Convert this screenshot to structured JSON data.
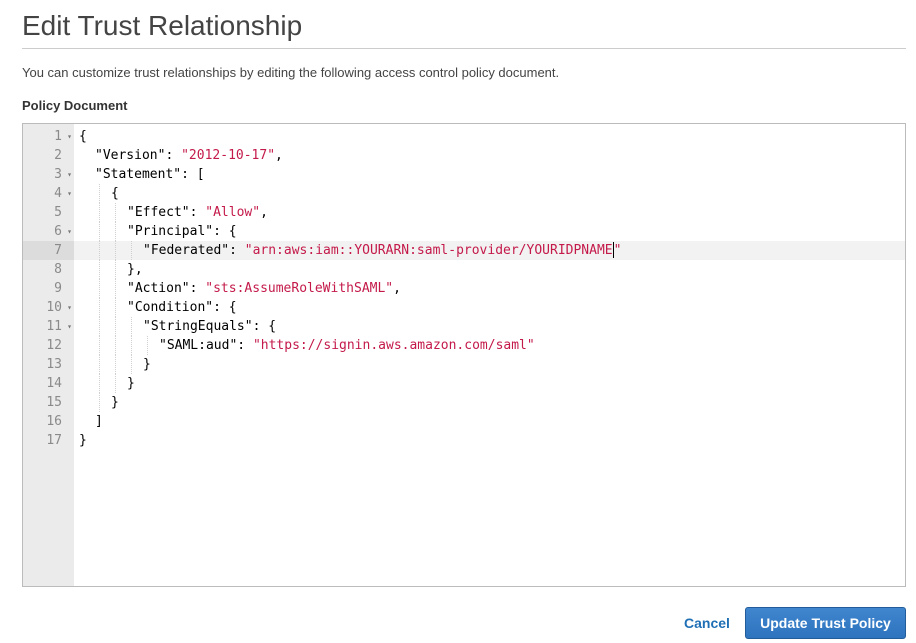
{
  "header": {
    "title": "Edit Trust Relationship",
    "description": "You can customize trust relationships by editing the following access control policy document."
  },
  "editor": {
    "label": "Policy Document",
    "active_line": 7,
    "lines": [
      {
        "number": "1",
        "foldable": true,
        "indent": 0,
        "tokens": [
          {
            "t": "punc",
            "v": "{"
          }
        ]
      },
      {
        "number": "2",
        "foldable": false,
        "indent": 1,
        "tokens": [
          {
            "t": "key",
            "v": "\"Version\""
          },
          {
            "t": "punc",
            "v": ": "
          },
          {
            "t": "str",
            "v": "\"2012-10-17\""
          },
          {
            "t": "punc",
            "v": ","
          }
        ]
      },
      {
        "number": "3",
        "foldable": true,
        "indent": 1,
        "tokens": [
          {
            "t": "key",
            "v": "\"Statement\""
          },
          {
            "t": "punc",
            "v": ": ["
          }
        ]
      },
      {
        "number": "4",
        "foldable": true,
        "indent": 2,
        "tokens": [
          {
            "t": "punc",
            "v": "{"
          }
        ]
      },
      {
        "number": "5",
        "foldable": false,
        "indent": 3,
        "tokens": [
          {
            "t": "key",
            "v": "\"Effect\""
          },
          {
            "t": "punc",
            "v": ": "
          },
          {
            "t": "str",
            "v": "\"Allow\""
          },
          {
            "t": "punc",
            "v": ","
          }
        ]
      },
      {
        "number": "6",
        "foldable": true,
        "indent": 3,
        "tokens": [
          {
            "t": "key",
            "v": "\"Principal\""
          },
          {
            "t": "punc",
            "v": ": {"
          }
        ]
      },
      {
        "number": "7",
        "foldable": false,
        "indent": 4,
        "tokens": [
          {
            "t": "key",
            "v": "\"Federated\""
          },
          {
            "t": "punc",
            "v": ": "
          },
          {
            "t": "str",
            "v": "\"arn:aws:iam::YOURARN:saml-provider/YOURIDPNAME"
          },
          {
            "t": "caret",
            "v": ""
          },
          {
            "t": "str",
            "v": "\""
          }
        ]
      },
      {
        "number": "8",
        "foldable": false,
        "indent": 3,
        "tokens": [
          {
            "t": "punc",
            "v": "},"
          }
        ]
      },
      {
        "number": "9",
        "foldable": false,
        "indent": 3,
        "tokens": [
          {
            "t": "key",
            "v": "\"Action\""
          },
          {
            "t": "punc",
            "v": ": "
          },
          {
            "t": "str",
            "v": "\"sts:AssumeRoleWithSAML\""
          },
          {
            "t": "punc",
            "v": ","
          }
        ]
      },
      {
        "number": "10",
        "foldable": true,
        "indent": 3,
        "tokens": [
          {
            "t": "key",
            "v": "\"Condition\""
          },
          {
            "t": "punc",
            "v": ": {"
          }
        ]
      },
      {
        "number": "11",
        "foldable": true,
        "indent": 4,
        "tokens": [
          {
            "t": "key",
            "v": "\"StringEquals\""
          },
          {
            "t": "punc",
            "v": ": {"
          }
        ]
      },
      {
        "number": "12",
        "foldable": false,
        "indent": 5,
        "tokens": [
          {
            "t": "key",
            "v": "\"SAML:aud\""
          },
          {
            "t": "punc",
            "v": ": "
          },
          {
            "t": "str",
            "v": "\"https://signin.aws.amazon.com/saml\""
          }
        ]
      },
      {
        "number": "13",
        "foldable": false,
        "indent": 4,
        "tokens": [
          {
            "t": "punc",
            "v": "}"
          }
        ]
      },
      {
        "number": "14",
        "foldable": false,
        "indent": 3,
        "tokens": [
          {
            "t": "punc",
            "v": "}"
          }
        ]
      },
      {
        "number": "15",
        "foldable": false,
        "indent": 2,
        "tokens": [
          {
            "t": "punc",
            "v": "}"
          }
        ]
      },
      {
        "number": "16",
        "foldable": false,
        "indent": 1,
        "tokens": [
          {
            "t": "punc",
            "v": "]"
          }
        ]
      },
      {
        "number": "17",
        "foldable": false,
        "indent": 0,
        "tokens": [
          {
            "t": "punc",
            "v": "}"
          }
        ]
      }
    ]
  },
  "actions": {
    "cancel_label": "Cancel",
    "submit_label": "Update Trust Policy"
  },
  "colors": {
    "string": "#c41a4a",
    "primary_button": "#2e73bd",
    "link": "#1f6fb5"
  }
}
